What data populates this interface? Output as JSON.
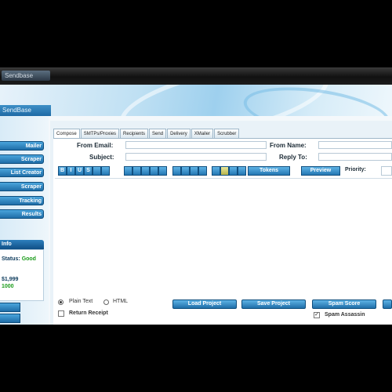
{
  "window": {
    "title": "Sendbase"
  },
  "banner": {
    "brand": "SendBase"
  },
  "sidebar": {
    "items": [
      {
        "label": "Mailer"
      },
      {
        "label": "Scraper"
      },
      {
        "label": "List Creator"
      },
      {
        "label": "Scraper"
      },
      {
        "label": "Tracking"
      },
      {
        "label": "Results"
      }
    ],
    "panel_title": "Info",
    "status_label": "Status:",
    "status_value": "Good",
    "credits_label": "$1,999",
    "credits_value": "1000"
  },
  "tabs": [
    "Compose",
    "SMTPs/Proxies",
    "Recipients",
    "Send",
    "Delivery",
    "XMailer",
    "Scrubber"
  ],
  "form": {
    "from_email_label": "From Email:",
    "from_name_label": "From Name:",
    "subject_label": "Subject:",
    "reply_to_label": "Reply To:",
    "toolbar_letters": [
      "B",
      "I",
      "U",
      "S"
    ],
    "tokens_label": "Tokens",
    "preview_label": "Preview",
    "priority_label": "Priority:"
  },
  "bottom": {
    "plain_text_label": "Plain Text",
    "html_label": "HTML",
    "return_receipt_label": "Return Receipt",
    "load_project_label": "Load Project",
    "save_project_label": "Save Project",
    "spam_score_label": "Spam Score",
    "spam_assassin_label": "Spam Assassin"
  },
  "colors": {
    "accent": "#1f6ea8",
    "good": "#1a9b1a"
  }
}
